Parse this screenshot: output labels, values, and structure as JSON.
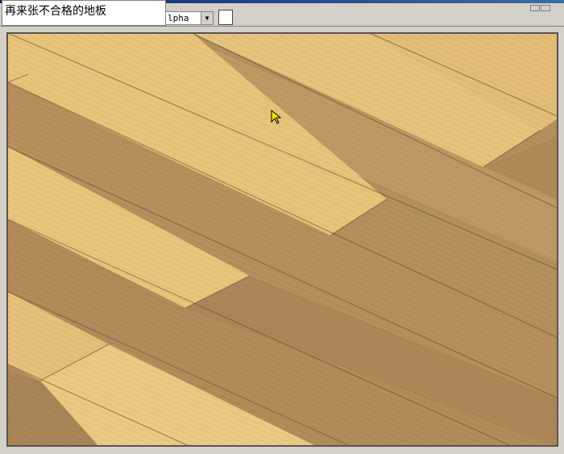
{
  "caption": {
    "text": "再来张不合格的地板"
  },
  "toolbar": {
    "channel_value": "lpha",
    "arrow_glyph": "▼"
  },
  "colors": {
    "light_plank": "#e9c57c",
    "mid_plank": "#c59a62",
    "dark_plank": "#a8865a",
    "seam": "#6b5233",
    "frame": "#d4d0c8"
  },
  "icons": {
    "cursor": "arrow-cursor-icon"
  }
}
